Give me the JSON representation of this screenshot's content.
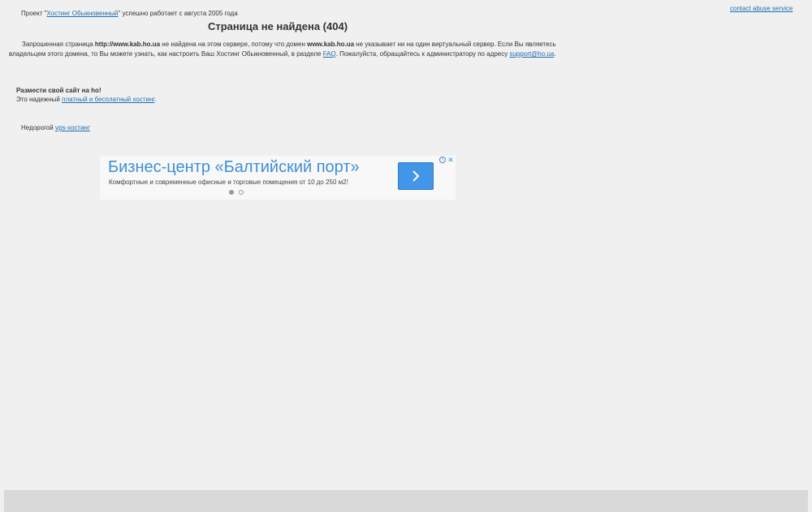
{
  "header": {
    "abuse_link": "contact abuse service",
    "project_prefix": "Проект \"",
    "project_link": "Хостинг Обыкновенный",
    "project_suffix": "\" успешно работает с августа 2005 года"
  },
  "main": {
    "title": "Страница не найдена (404)",
    "desc_part1": "Запрошенная страница ",
    "requested_url": "http://www.kab.ho.ua",
    "desc_part2": " не найдена на этом сервере, потому что домен ",
    "domain": "www.kab.ho.ua",
    "desc_part3": " не указывает ни на один виртуальный сервер. Если Вы являетесь владельцем этого домена, то Вы можете узнать, как настроить Ваш Хостинг Обыкновенный, в разделе ",
    "faq_link": "FAQ",
    "desc_part4": ". Пожалуйста, обращайтесь к администратору по адресу ",
    "support_link": "support@ho.ua",
    "desc_part5": "."
  },
  "promo": {
    "title": "Размести свой сайт на ho!",
    "text_prefix": "Это надежный ",
    "link": "платный и бесплатный хостинг",
    "text_suffix": "."
  },
  "vps": {
    "prefix": "Недорогой ",
    "link": "vps-хостинг"
  },
  "ad": {
    "headline": "Бизнес-центр «Балтийский порт»",
    "subtitle": "Комфортные и современные офисные и торговые помещения от 10 до 250 м2!",
    "info_glyph": "i",
    "close_glyph": "✕",
    "accent_color": "#4196e8"
  }
}
